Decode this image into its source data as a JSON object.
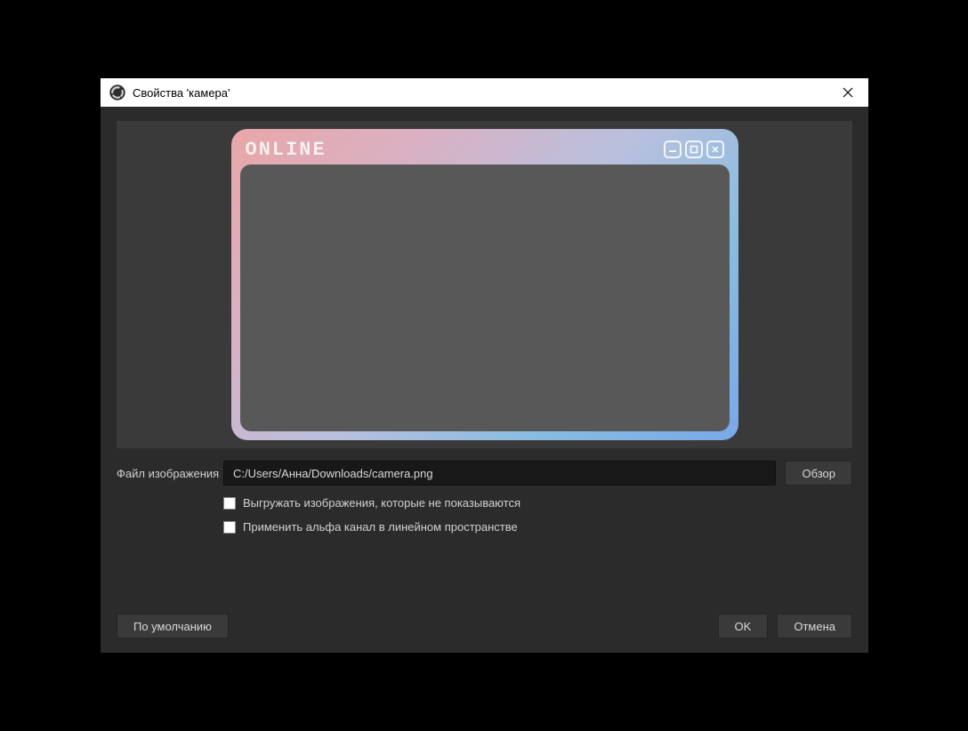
{
  "dialog": {
    "title": "Свойства 'камера'"
  },
  "preview": {
    "overlay_label": "ONLINE"
  },
  "form": {
    "file_label": "Файл изображения",
    "file_path": "C:/Users/Анна/Downloads/camera.png",
    "browse_label": "Обзор",
    "unload_label": "Выгружать изображения, которые не показываются",
    "alpha_label": "Применить альфа канал в линейном пространстве"
  },
  "buttons": {
    "defaults": "По умолчанию",
    "ok": "OK",
    "cancel": "Отмена"
  }
}
